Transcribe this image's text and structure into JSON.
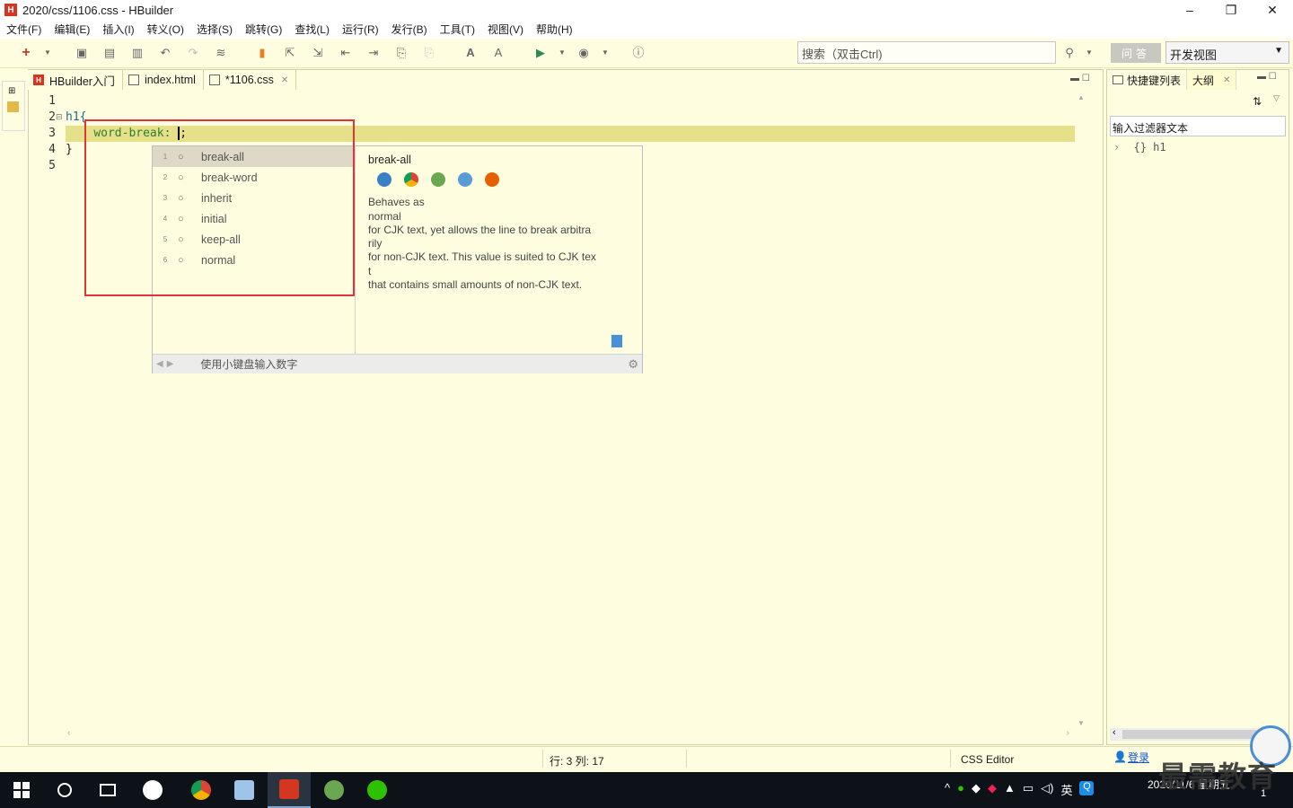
{
  "window": {
    "title": "2020/css/1106.css  -  HBuilder",
    "app_icon": "H"
  },
  "menu": [
    "文件(F)",
    "编辑(E)",
    "插入(I)",
    "转义(O)",
    "选择(S)",
    "跳转(G)",
    "查找(L)",
    "运行(R)",
    "发行(B)",
    "工具(T)",
    "视图(V)",
    "帮助(H)"
  ],
  "toolbar": {
    "search_placeholder": "搜索（双击Ctrl)",
    "wenda_label": "问答",
    "view_select": "开发视图"
  },
  "tabs": [
    {
      "label": "HBuilder入门",
      "icon": "hbuilder-icon"
    },
    {
      "label": "index.html",
      "icon": "html-file-icon"
    },
    {
      "label": "*1106.css",
      "icon": "css-file-icon",
      "active": true
    }
  ],
  "editor": {
    "line_numbers": [
      "1",
      "2",
      "3",
      "4",
      "5"
    ],
    "lines": {
      "l2_selector": "h1{",
      "l3_property": "word-break: ",
      "l3_value": ";",
      "l4": "}"
    }
  },
  "autocomplete": {
    "items": [
      {
        "num": "1",
        "label": "break-all"
      },
      {
        "num": "2",
        "label": "break-word"
      },
      {
        "num": "3",
        "label": "inherit"
      },
      {
        "num": "4",
        "label": "initial"
      },
      {
        "num": "5",
        "label": "keep-all"
      },
      {
        "num": "6",
        "label": "normal"
      }
    ],
    "doc_title": "break-all",
    "doc_text": [
      "Behaves as",
      "normal",
      "for CJK text, yet allows the line to break arbitra",
      "rily",
      "for non-CJK text. This value is suited to CJK tex",
      "t",
      "that contains small amounts of non-CJK text."
    ],
    "footer_hint": "使用小键盘输入数字"
  },
  "right_panel": {
    "tabs": [
      "快捷键列表",
      "大纲"
    ],
    "filter_placeholder": "输入过滤器文本",
    "tree_item": "{} h1"
  },
  "status": {
    "position": "行: 3 列: 17",
    "editor_type": "CSS Editor",
    "login": "登录"
  },
  "taskbar": {
    "tray_lang": "英",
    "clock_time": "",
    "clock_date": "2020/11/6 星期五",
    "notification_count": "1"
  },
  "watermark": "最需教育"
}
